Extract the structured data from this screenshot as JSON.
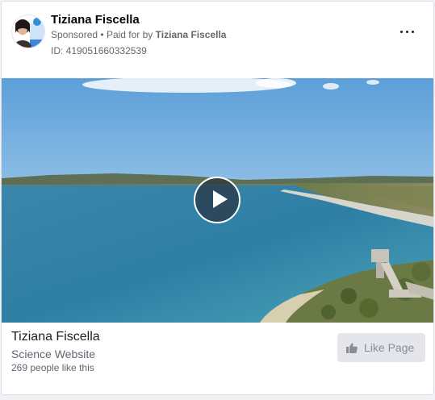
{
  "post": {
    "author": "Tiziana Fiscella",
    "sponsored_label": "Sponsored",
    "separator": "•",
    "paid_for_prefix": "Paid for by",
    "paid_for_name": "Tiziana Fiscella",
    "ad_id": "ID: 419051660332539"
  },
  "media": {
    "type": "video"
  },
  "footer": {
    "page_name": "Tiziana Fiscella",
    "category": "Science Website",
    "likes": "269 people like this",
    "like_button_label": "Like Page"
  },
  "colors": {
    "card_bg": "#ffffff",
    "muted_text": "#65676b",
    "button_bg": "#e4e6eb",
    "button_text": "#8a8d91"
  },
  "icons": [
    "more-options-icon",
    "play-icon",
    "thumbs-up-icon"
  ]
}
